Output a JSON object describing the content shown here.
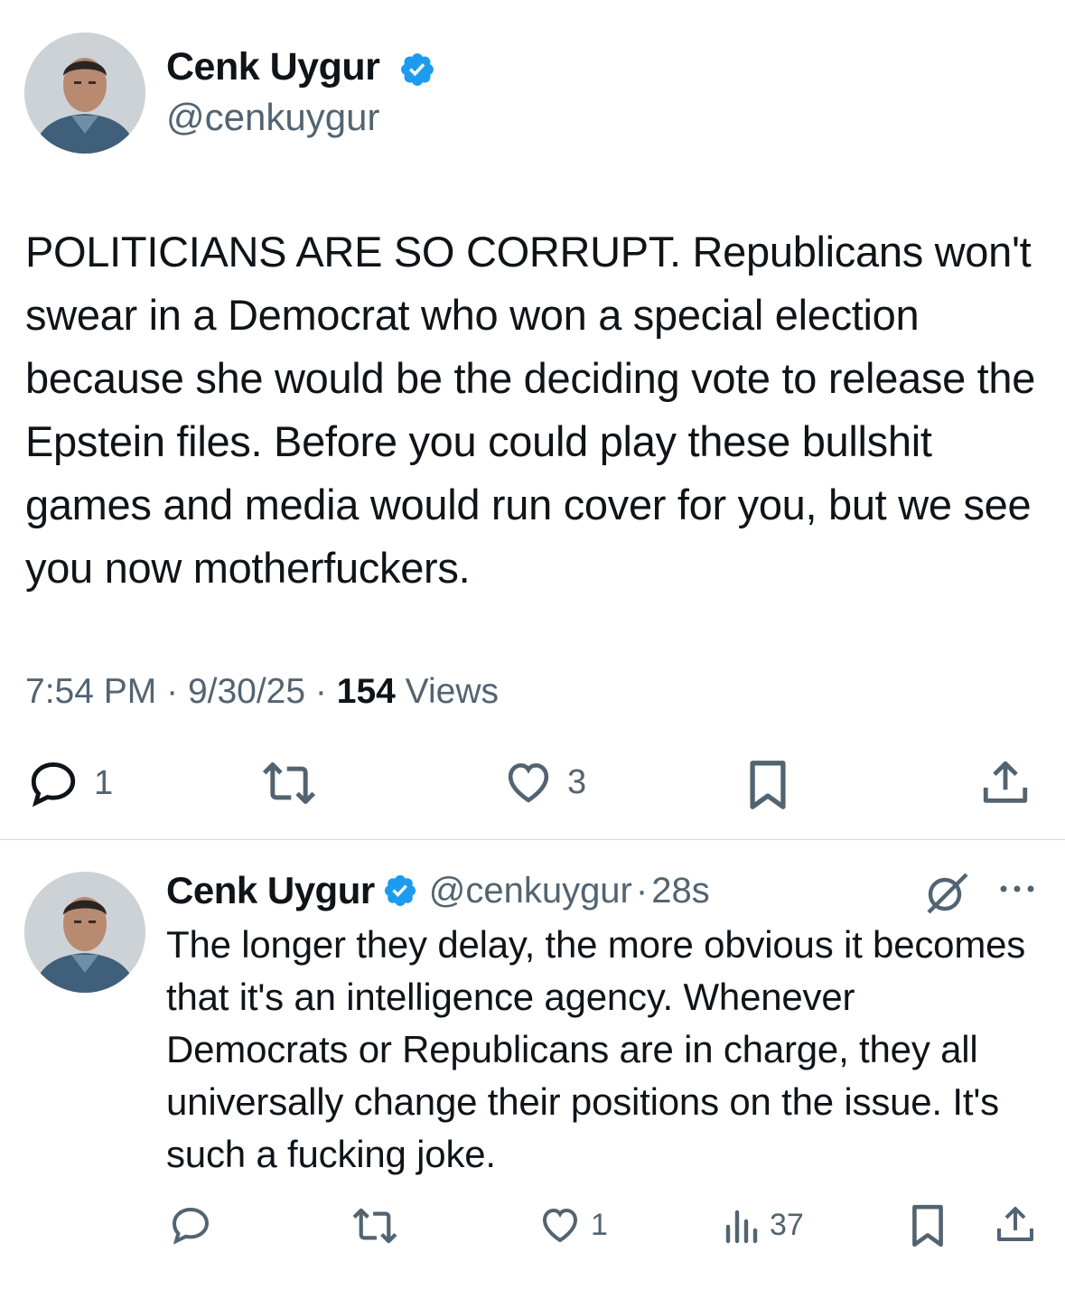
{
  "main_tweet": {
    "author_name": "Cenk Uygur",
    "author_handle": "@cenkuygur",
    "text": "POLITICIANS ARE SO CORRUPT. Republicans won't swear in a Democrat who won a special election because she would be the deciding vote to release the Epstein files. Before you could play these bullshit games and media would run cover for you, but we see you now motherfuckers.",
    "time": "7:54 PM",
    "separator": "·",
    "date": "9/30/25",
    "views_count": "154",
    "views_label": "Views",
    "reply_count": "1",
    "like_count": "3"
  },
  "reply_tweet": {
    "author_name": "Cenk Uygur",
    "author_handle": "@cenkuygur",
    "separator": "·",
    "age": "28s",
    "text": "The longer they delay, the more obvious it becomes that it's an intelligence agency. Whenever Democrats or Republicans are in charge, they all universally change their positions on the issue. It's such a fucking joke.",
    "like_count": "1",
    "views_count": "37"
  },
  "colors": {
    "verified_blue": "#1d9bf0",
    "secondary_text": "#536471",
    "primary_text": "#0f1419",
    "divider": "#cfd9de"
  },
  "icons": [
    "verified-badge-icon",
    "reply-icon",
    "retweet-icon",
    "like-icon",
    "bookmark-icon",
    "share-icon",
    "views-icon",
    "grok-icon",
    "more-icon"
  ]
}
